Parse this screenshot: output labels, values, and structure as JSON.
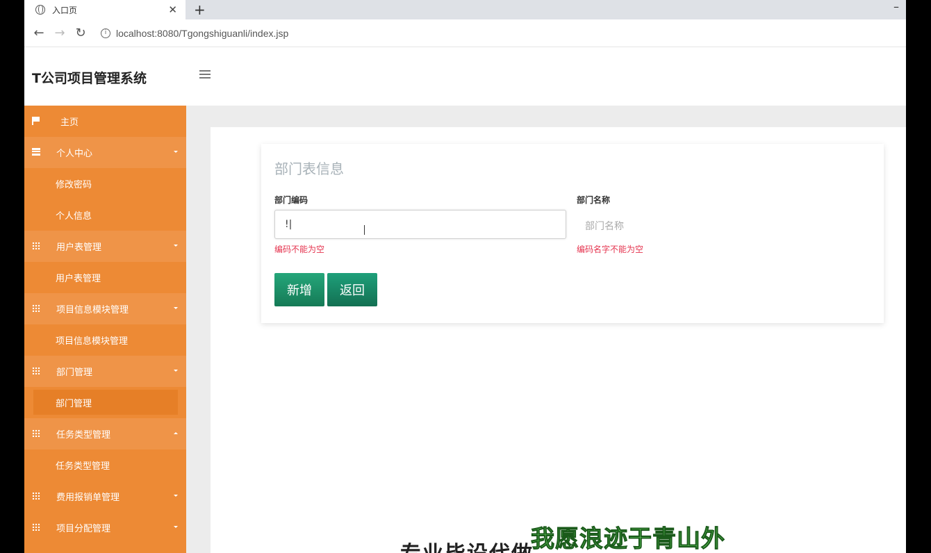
{
  "browser": {
    "tab_title": "入口页",
    "tab_close": "✕",
    "new_tab": "+",
    "minimize": "–",
    "url": "localhost:8080/Tgongshiguanli/index.jsp",
    "back": "←",
    "forward": "→",
    "reload": "↻"
  },
  "app": {
    "title": "T公司项目管理系统"
  },
  "sidebar": {
    "items": [
      {
        "label": "主页",
        "icon": "flag-icon"
      },
      {
        "label": "个人中心",
        "icon": "list-icon"
      },
      {
        "label": "修改密码"
      },
      {
        "label": "个人信息"
      },
      {
        "label": "用户表管理",
        "icon": "grid-icon"
      },
      {
        "label": "用户表管理"
      },
      {
        "label": "项目信息模块管理",
        "icon": "grid-icon"
      },
      {
        "label": "项目信息模块管理"
      },
      {
        "label": "部门管理",
        "icon": "grid-icon"
      },
      {
        "label": "部门管理"
      },
      {
        "label": "任务类型管理",
        "icon": "grid-icon"
      },
      {
        "label": "任务类型管理"
      },
      {
        "label": "费用报销单管理",
        "icon": "grid-icon"
      },
      {
        "label": "项目分配管理",
        "icon": "grid-icon"
      }
    ]
  },
  "form": {
    "title": "部门表信息",
    "code_label": "部门编码",
    "code_value": "!|",
    "code_error": "编码不能为空",
    "name_label": "部门名称",
    "name_placeholder": "部门名称",
    "name_error": "编码名字不能为空",
    "add_button": "新增",
    "back_button": "返回"
  },
  "captions": {
    "a": "专业毕设代做",
    "b": "我愿浪迹于青山外"
  },
  "colors": {
    "sidebar_bg": "#ed8a35",
    "button_green": "#1e9468",
    "error_red": "#e5344f"
  }
}
